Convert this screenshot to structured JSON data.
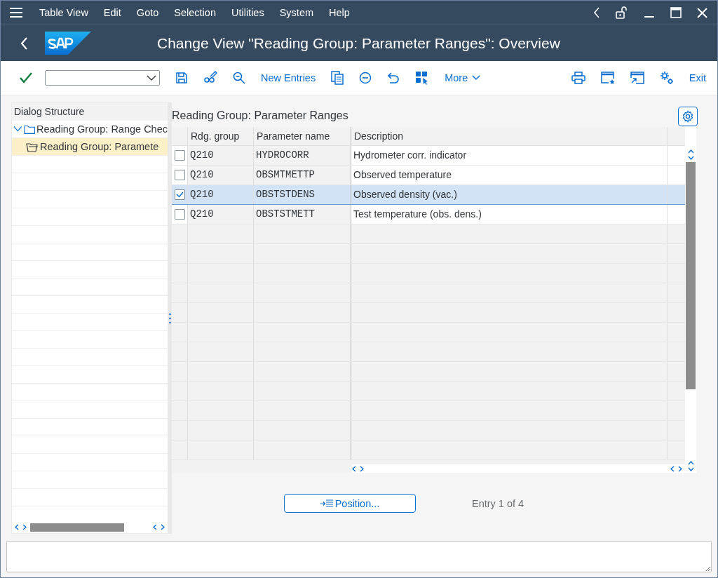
{
  "menu_bar": {
    "items": [
      "Table View",
      "Edit",
      "Goto",
      "Selection",
      "Utilities",
      "System",
      "Help"
    ]
  },
  "title_bar": {
    "title": "Change View \"Reading Group: Parameter Ranges\": Overview"
  },
  "toolbar": {
    "new_entries": "New Entries",
    "more": "More",
    "exit": "Exit"
  },
  "dialog_structure": {
    "title": "Dialog Structure",
    "tree": [
      {
        "label": "Reading Group: Range Chec",
        "expanded": true,
        "selected": false,
        "children": [
          {
            "label": "Reading Group: Paramete",
            "selected": true
          }
        ]
      }
    ]
  },
  "table": {
    "title": "Reading Group: Parameter Ranges",
    "columns": [
      "Rdg. group",
      "Parameter name",
      "Description"
    ],
    "rows": [
      {
        "checked": false,
        "selected": false,
        "rdg_group": "Q210",
        "parameter_name": "HYDROCORR",
        "description": "Hydrometer corr. indicator"
      },
      {
        "checked": false,
        "selected": false,
        "rdg_group": "Q210",
        "parameter_name": "OBSMTMETTP",
        "description": "Observed temperature"
      },
      {
        "checked": true,
        "selected": true,
        "rdg_group": "Q210",
        "parameter_name": "OBSTSTDENS",
        "description": "Observed density (vac.)"
      },
      {
        "checked": false,
        "selected": false,
        "rdg_group": "Q210",
        "parameter_name": "OBSTSTMETT",
        "description": "Test temperature (obs. dens.)"
      }
    ]
  },
  "position_button": "Position...",
  "entry_info": "Entry 1 of 4"
}
